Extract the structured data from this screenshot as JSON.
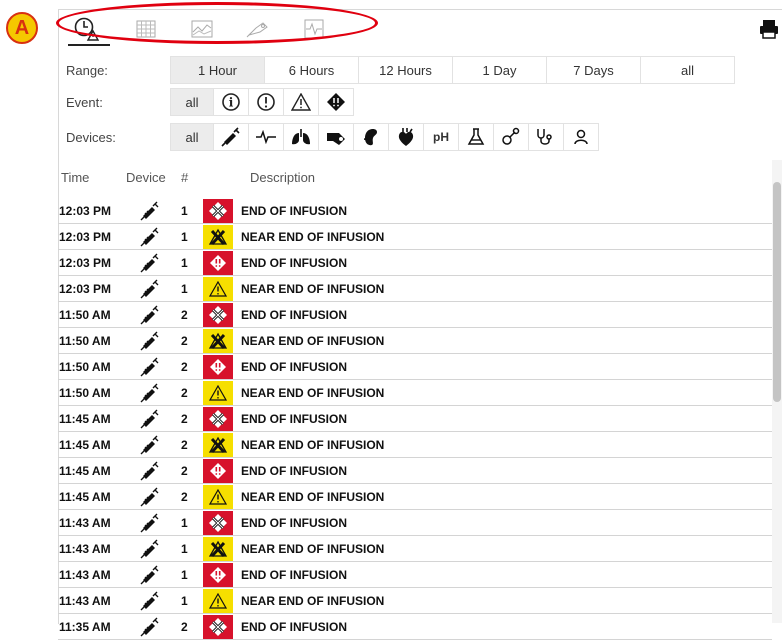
{
  "toolbar": {
    "icons": [
      "clock-alarm-icon",
      "grid-table-icon",
      "chart-icon",
      "pump-icon",
      "monitor-trace-icon"
    ],
    "print_icon": "printer-icon",
    "callout": "A"
  },
  "filters": {
    "range": {
      "label": "Range:",
      "options": [
        "1 Hour",
        "6 Hours",
        "12 Hours",
        "1 Day",
        "7 Days",
        "all"
      ],
      "selected": "1 Hour"
    },
    "event": {
      "label": "Event:",
      "all": "all",
      "icons": [
        "info-icon",
        "exclamation-circle-icon",
        "warning-triangle-icon",
        "alarm-diamond-icon"
      ]
    },
    "devices": {
      "label": "Devices:",
      "all": "all",
      "ph": "pH",
      "icons": [
        "syringe-icon",
        "ecg-icon",
        "lungs-icon",
        "pump-device-icon",
        "kidney-icon",
        "heart-icon",
        "ph-icon",
        "flask-icon",
        "pacifier-icon",
        "stethoscope-icon",
        "person-icon"
      ]
    }
  },
  "table": {
    "headers": {
      "time": "Time",
      "device": "Device",
      "num": "#",
      "description": "Description"
    },
    "rows": [
      {
        "time": "12:03 PM",
        "num": "1",
        "type": "red-x",
        "desc": "END OF INFUSION"
      },
      {
        "time": "12:03 PM",
        "num": "1",
        "type": "yellow-x",
        "desc": "NEAR END OF INFUSION"
      },
      {
        "time": "12:03 PM",
        "num": "1",
        "type": "red-diamond",
        "desc": "END OF INFUSION"
      },
      {
        "time": "12:03 PM",
        "num": "1",
        "type": "yellow-tri",
        "desc": "NEAR END OF INFUSION"
      },
      {
        "time": "11:50 AM",
        "num": "2",
        "type": "red-x",
        "desc": "END OF INFUSION"
      },
      {
        "time": "11:50 AM",
        "num": "2",
        "type": "yellow-x",
        "desc": "NEAR END OF INFUSION"
      },
      {
        "time": "11:50 AM",
        "num": "2",
        "type": "red-diamond",
        "desc": "END OF INFUSION"
      },
      {
        "time": "11:50 AM",
        "num": "2",
        "type": "yellow-tri",
        "desc": "NEAR END OF INFUSION"
      },
      {
        "time": "11:45 AM",
        "num": "2",
        "type": "red-x",
        "desc": "END OF INFUSION"
      },
      {
        "time": "11:45 AM",
        "num": "2",
        "type": "yellow-x",
        "desc": "NEAR END OF INFUSION"
      },
      {
        "time": "11:45 AM",
        "num": "2",
        "type": "red-diamond",
        "desc": "END OF INFUSION"
      },
      {
        "time": "11:45 AM",
        "num": "2",
        "type": "yellow-tri",
        "desc": "NEAR END OF INFUSION"
      },
      {
        "time": "11:43 AM",
        "num": "1",
        "type": "red-x",
        "desc": "END OF INFUSION"
      },
      {
        "time": "11:43 AM",
        "num": "1",
        "type": "yellow-x",
        "desc": "NEAR END OF INFUSION"
      },
      {
        "time": "11:43 AM",
        "num": "1",
        "type": "red-diamond",
        "desc": "END OF INFUSION"
      },
      {
        "time": "11:43 AM",
        "num": "1",
        "type": "yellow-tri",
        "desc": "NEAR END OF INFUSION"
      },
      {
        "time": "11:35 AM",
        "num": "2",
        "type": "red-x",
        "desc": "END OF INFUSION"
      }
    ]
  },
  "colors": {
    "alarm_red": "#d7122b",
    "warning_yellow": "#f6df00",
    "callout_red": "#e0000f",
    "callout_badge": "#f5c800"
  }
}
